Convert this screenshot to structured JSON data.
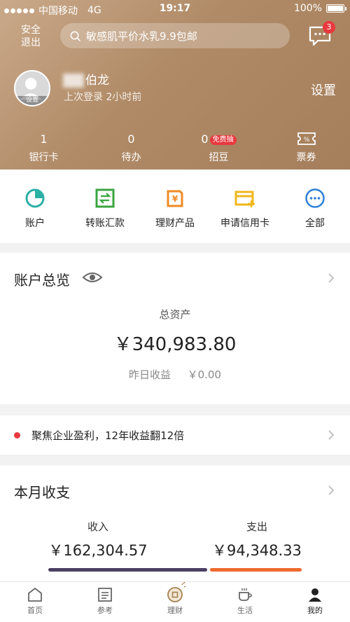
{
  "status_bar": {
    "carrier": "中国移动",
    "network": "4G",
    "time": "19:17",
    "battery": "100%"
  },
  "header": {
    "safe_exit": "安全\n退出",
    "search_placeholder": "敏感肌平价水乳9.9包邮",
    "message_badge": "3",
    "user_name": "伯龙",
    "last_login": "上次登录  2小时前",
    "avatar_tag": "设置",
    "settings": "设置"
  },
  "stats": [
    {
      "num": "1",
      "label": "银行卡"
    },
    {
      "num": "0",
      "label": "待办"
    },
    {
      "num": "0",
      "label": "招豆",
      "tag": "免费抽"
    },
    {
      "label": "票券"
    }
  ],
  "quick_actions": [
    {
      "label": "账户",
      "icon": "pie-chart-icon"
    },
    {
      "label": "转账汇款",
      "icon": "transfer-icon"
    },
    {
      "label": "理财产品",
      "icon": "wealth-icon"
    },
    {
      "label": "申请信用卡",
      "icon": "credit-card-icon"
    },
    {
      "label": "全部",
      "icon": "more-icon"
    }
  ],
  "overview": {
    "title": "账户总览",
    "total_label": "总资产",
    "total_value": "￥340,983.80",
    "yesterday_label": "昨日收益",
    "yesterday_value": "￥0.00"
  },
  "promo": {
    "text": "聚焦企业盈利，12年收益翻12倍"
  },
  "monthly": {
    "title": "本月收支",
    "income_label": "收入",
    "income_value": "￥162,304.57",
    "expense_label": "支出",
    "expense_value": "￥94,348.33",
    "income_share": 0.632
  },
  "tabs": [
    {
      "label": "首页",
      "icon": "home-icon"
    },
    {
      "label": "参考",
      "icon": "reference-icon"
    },
    {
      "label": "理财",
      "icon": "coin-icon"
    },
    {
      "label": "生活",
      "icon": "coffee-icon"
    },
    {
      "label": "我的",
      "icon": "user-icon",
      "active": true
    }
  ],
  "colors": {
    "accent_red": "#e8393f",
    "header_brown": "#b08a66",
    "income_bar": "#4b3f63",
    "expense_bar": "#f0692e"
  }
}
